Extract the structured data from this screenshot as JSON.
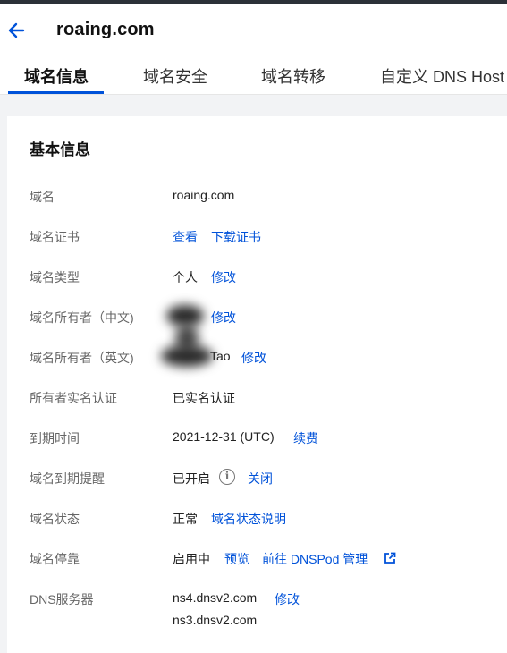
{
  "header": {
    "title": "roaing.com"
  },
  "tabs": [
    {
      "label": "域名信息",
      "active": true
    },
    {
      "label": "域名安全"
    },
    {
      "label": "域名转移"
    },
    {
      "label": "自定义 DNS Host"
    }
  ],
  "basic_info": {
    "title": "基本信息",
    "rows": {
      "domain": {
        "label": "域名",
        "value": "roaing.com"
      },
      "certificate": {
        "label": "域名证书",
        "link_view": "查看",
        "link_download": "下载证书"
      },
      "type": {
        "label": "域名类型",
        "value": "个人",
        "link": "修改"
      },
      "owner_cn": {
        "label": "域名所有者（中文)",
        "link": "修改"
      },
      "owner_en": {
        "label": "域名所有者（英文)",
        "value": "Tao",
        "link": "修改"
      },
      "verification": {
        "label": "所有者实名认证",
        "value": "已实名认证"
      },
      "expiry": {
        "label": "到期时间",
        "value": "2021-12-31 (UTC)",
        "link": "续费"
      },
      "reminder": {
        "label": "域名到期提醒",
        "value": "已开启",
        "link": "关闭"
      },
      "status": {
        "label": "域名状态",
        "value": "正常",
        "link": "域名状态说明"
      },
      "parking": {
        "label": "域名停靠",
        "value": "启用中",
        "link_preview": "预览",
        "link_dnspod": "前往 DNSPod 管理"
      },
      "dns": {
        "label": "DNS服务器",
        "ns1": "ns4.dnsv2.com",
        "ns2": "ns3.dnsv2.com",
        "link": "修改"
      }
    }
  },
  "colors": {
    "accent": "#0052d9",
    "topbar": "#2b3138"
  },
  "icons": {
    "back": "arrow-left-icon",
    "info": "info-circle-icon",
    "external": "external-link-icon"
  }
}
